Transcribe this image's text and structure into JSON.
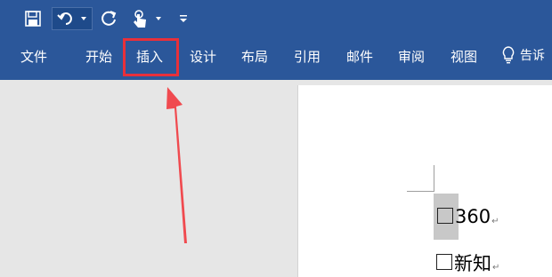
{
  "quick_access": {
    "save_icon": "save-icon",
    "undo_icon": "undo-icon",
    "redo_icon": "redo-icon",
    "touch_icon": "touch-mode-icon",
    "customize_icon": "customize-qat-icon"
  },
  "tabs": [
    {
      "label": "文件"
    },
    {
      "label": "开始"
    },
    {
      "label": "插入"
    },
    {
      "label": "设计"
    },
    {
      "label": "布局"
    },
    {
      "label": "引用"
    },
    {
      "label": "邮件"
    },
    {
      "label": "审阅"
    },
    {
      "label": "视图"
    }
  ],
  "tell_me": {
    "icon": "lightbulb-icon",
    "label": "告诉"
  },
  "document": {
    "items": [
      {
        "text": "360"
      },
      {
        "text": "新知"
      }
    ]
  },
  "colors": {
    "ribbon": "#2b579a",
    "highlight": "#e8303a",
    "canvas": "#e6e6e6"
  }
}
